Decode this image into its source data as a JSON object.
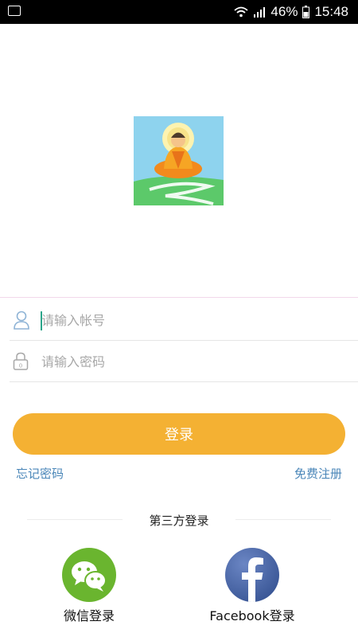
{
  "status_bar": {
    "battery": "46%",
    "time": "15:48"
  },
  "form": {
    "account_placeholder": "请输入帐号",
    "password_placeholder": "请输入密码",
    "login_label": "登录",
    "forgot_password": "忘记密码",
    "register": "免费注册"
  },
  "third_party": {
    "title": "第三方登录",
    "wechat_label": "微信登录",
    "facebook_label": "Facebook登录"
  },
  "colors": {
    "accent": "#f4b133",
    "link": "#4a86b8",
    "wechat": "#6ab52f",
    "facebook": "#3b5998"
  }
}
